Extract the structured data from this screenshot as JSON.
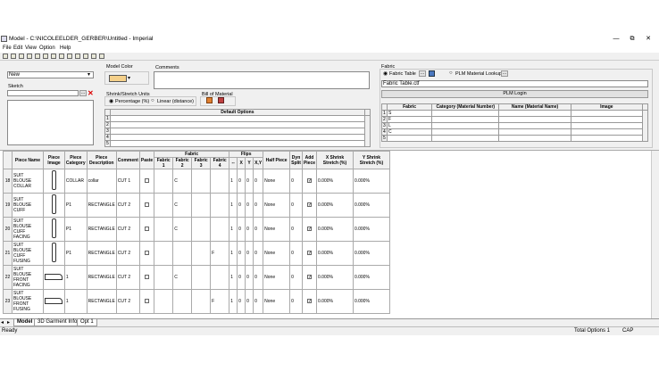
{
  "window": {
    "title": "Model - C:\\NICOLEELDER_GERBER\\Untitled - Imperial",
    "minimize": "—",
    "maximize": "⧉",
    "close": "✕"
  },
  "menu": [
    "File",
    "Edit",
    "View",
    "Option",
    "Help"
  ],
  "toolbar_icons": [
    "new-icon",
    "open-icon",
    "save-icon",
    "print-icon",
    "save-as-icon",
    "copy-icon",
    "cut-icon",
    "paste-icon",
    "undo-icon",
    "redo-icon",
    "delete-icon",
    "find-icon",
    "help-icon"
  ],
  "left": {
    "size_select": "New",
    "sketch_label": "Sketch",
    "browse": "...",
    "delete": "✕"
  },
  "model_color": {
    "label": "Model Color",
    "color": "#f5d08a"
  },
  "comments": {
    "label": "Comments",
    "value": ""
  },
  "shrink": {
    "label": "Shrink/Stretch Units",
    "option1": "Percentage (%)",
    "option2": "Linear (distance)"
  },
  "bill_of_material": {
    "label": "Bill of Material"
  },
  "default_options": {
    "header": "Default Options",
    "rows": [
      "1",
      "2",
      "3",
      "4",
      "5"
    ]
  },
  "fabric": {
    "label": "Fabric",
    "opt_table": "Fabric Table",
    "opt_plm": "PLM Material Lookup",
    "browse": "...",
    "file": "Fabric Table.ctf",
    "plm_login": "PLM Login",
    "columns": [
      "Fabric",
      "Category (Material Number)",
      "Name (Material Name)",
      "Image"
    ],
    "rows": [
      {
        "n": "1",
        "code": "S"
      },
      {
        "n": "2",
        "code": "F"
      },
      {
        "n": "3",
        "code": "L"
      },
      {
        "n": "4",
        "code": "C"
      },
      {
        "n": "5",
        "code": ""
      }
    ]
  },
  "grid": {
    "headers": {
      "piece_name": "Piece Name",
      "piece_image": "Piece Image",
      "piece_category": "Piece Category",
      "piece_description": "Piece Description",
      "comment": "Comment",
      "paste": "Paste",
      "fabric": "Fabric",
      "fabric1": "Fabric 1",
      "fabric2": "Fabric 2",
      "fabric3": "Fabric 3",
      "fabric4": "Fabric 4",
      "flips": "Flips",
      "flip_dash": "--",
      "flip_x": "X",
      "flip_y": "Y",
      "flip_xy": "X,Y",
      "half_piece": "Half Piece",
      "dyn_split": "Dyn Split",
      "add_piece": "Add Piece",
      "x_shrink": "X Shrink Stretch (%)",
      "y_shrink": "Y Shrink Stretch (%)"
    },
    "rows": [
      {
        "n": "18",
        "name": "SUIT BLOUSE COLLAR",
        "cat": "COLLAR",
        "desc": "collar",
        "comment": "CUT 1",
        "f1": "",
        "f2": "C",
        "f3": "",
        "f4": "",
        "fl": [
          "1",
          "0",
          "0",
          "0"
        ],
        "half": "None",
        "dyn": "0",
        "xs": "0.000%",
        "ys": "0.000%",
        "shape": "tall"
      },
      {
        "n": "19",
        "name": "SUIT BLOUSE CUFF",
        "cat": "P1",
        "desc": "RECTANGLE",
        "comment": "CUT 2",
        "f1": "",
        "f2": "C",
        "f3": "",
        "f4": "",
        "fl": [
          "1",
          "0",
          "0",
          "0"
        ],
        "half": "None",
        "dyn": "0",
        "xs": "0.000%",
        "ys": "0.000%",
        "shape": "tall"
      },
      {
        "n": "20",
        "name": "SUIT BLOUSE CUFF FACING",
        "cat": "P1",
        "desc": "RECTANGLE",
        "comment": "CUT 2",
        "f1": "",
        "f2": "C",
        "f3": "",
        "f4": "",
        "fl": [
          "1",
          "0",
          "0",
          "0"
        ],
        "half": "None",
        "dyn": "0",
        "xs": "0.000%",
        "ys": "0.000%",
        "shape": "tall"
      },
      {
        "n": "21",
        "name": "SUIT BLOUSE CUFF FUSING",
        "cat": "P1",
        "desc": "RECTANGLE",
        "comment": "CUT 2",
        "f1": "",
        "f2": "",
        "f3": "",
        "f4": "F",
        "fl": [
          "1",
          "0",
          "0",
          "0"
        ],
        "half": "None",
        "dyn": "0",
        "xs": "0.000%",
        "ys": "0.000%",
        "shape": "tall"
      },
      {
        "n": "22",
        "name": "SUIT BLOUSE FRONT FACING",
        "cat": "1",
        "desc": "RECTANGLE",
        "comment": "CUT 2",
        "f1": "",
        "f2": "C",
        "f3": "",
        "f4": "",
        "fl": [
          "1",
          "0",
          "0",
          "0"
        ],
        "half": "None",
        "dyn": "0",
        "xs": "0.000%",
        "ys": "0.000%",
        "shape": "wide"
      },
      {
        "n": "23",
        "name": "SUIT BLOUSE FRONT FUSING",
        "cat": "1",
        "desc": "RECTANGLE",
        "comment": "CUT 2",
        "f1": "",
        "f2": "",
        "f3": "",
        "f4": "F",
        "fl": [
          "1",
          "0",
          "0",
          "0"
        ],
        "half": "None",
        "dyn": "0",
        "xs": "0.000%",
        "ys": "0.000%",
        "shape": "wide"
      }
    ]
  },
  "tabs": {
    "model": "Model",
    "garment": "3D Garment Info",
    "opt": "Opt 1"
  },
  "status": {
    "ready": "Ready",
    "total_options": "Total Options 1",
    "cap": "CAP"
  }
}
